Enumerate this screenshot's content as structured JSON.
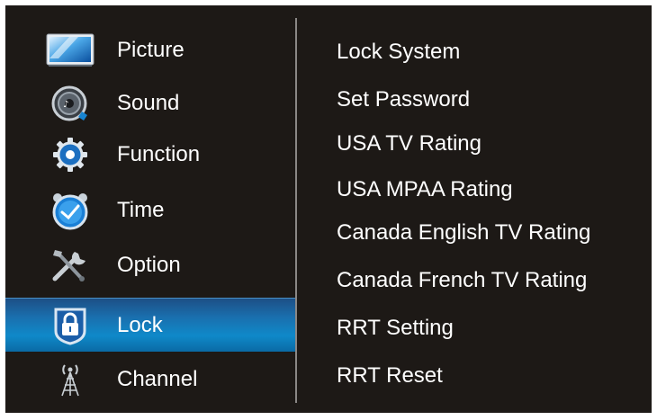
{
  "sidebar": {
    "items": [
      {
        "label": "Picture",
        "icon": "picture-icon"
      },
      {
        "label": "Sound",
        "icon": "speaker-icon"
      },
      {
        "label": "Function",
        "icon": "gear-icon"
      },
      {
        "label": "Time",
        "icon": "clock-icon"
      },
      {
        "label": "Option",
        "icon": "tools-icon"
      },
      {
        "label": "Lock",
        "icon": "padlock-icon",
        "selected": true
      },
      {
        "label": "Channel",
        "icon": "antenna-icon"
      }
    ]
  },
  "menu": {
    "items": [
      "Lock System",
      "Set Password",
      "USA TV Rating",
      "USA MPAA Rating",
      "Canada English TV Rating",
      "Canada French TV Rating",
      "RRT Setting",
      "RRT Reset"
    ]
  },
  "colors": {
    "background": "#1d1916",
    "highlight": "#0f89c9",
    "text": "#ffffff"
  }
}
